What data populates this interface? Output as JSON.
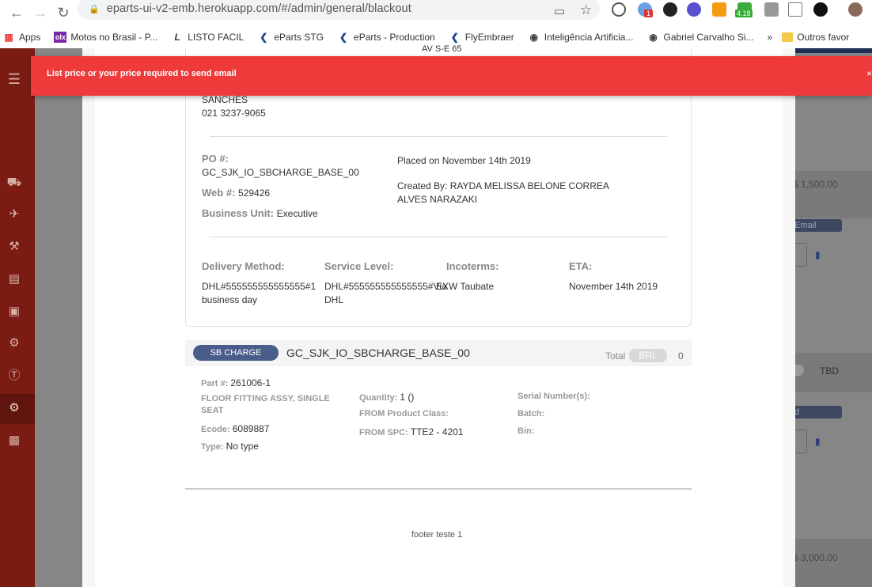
{
  "browser": {
    "url": "eparts-ui-v2-emb.herokuapp.com/#/admin/general/blackout",
    "badge_count": "1",
    "ext_badge": "4.18"
  },
  "bookmarks": [
    {
      "label": "Apps"
    },
    {
      "label": "Motos no Brasil - P..."
    },
    {
      "label": "LISTO FACIL"
    },
    {
      "label": "eParts STG"
    },
    {
      "label": "eParts - Production"
    },
    {
      "label": "FlyEmbraer"
    },
    {
      "label": "Inteligência Artificia..."
    },
    {
      "label": "Gabriel Carvalho Si..."
    },
    {
      "label": "»"
    },
    {
      "label": "Outros favor"
    }
  ],
  "toast": {
    "message": "List price or your price required to send email",
    "close": "×"
  },
  "background": {
    "price1": "$ 1,500.00",
    "email": "Email",
    "tbd": "TBD",
    "d": "d",
    "price2": "$ 3,000.00"
  },
  "address": {
    "line0": "AV S-E 65",
    "name": "SANCHES",
    "phone": "021 3237-9065"
  },
  "order": {
    "po_label": "PO #:",
    "po_value": "GC_SJK_IO_SBCHARGE_BASE_00",
    "web_label": "Web #:",
    "web_value": "529426",
    "bu_label": "Business Unit:",
    "bu_value": "Executive",
    "placed": "Placed on November 14th 2019",
    "created_by_1": "Created By: RAYDA MELISSA BELONE CORREA",
    "created_by_2": "ALVES NARAZAKI"
  },
  "shipping": {
    "delivery_label": "Delivery Method:",
    "delivery_1": "DHL#555555555555555#1",
    "delivery_2": "business day",
    "service_label": "Service Level:",
    "service_1": "DHL#555555555555555#Via",
    "service_2": "DHL",
    "incoterms_label": "Incoterms:",
    "incoterms_value": "EXW Taubate",
    "eta_label": "ETA:",
    "eta_value": "November 14th 2019"
  },
  "item": {
    "type": "SB CHARGE",
    "title": "GC_SJK_IO_SBCHARGE_BASE_00",
    "total_label": "Total",
    "currency": "BRL",
    "total": "0",
    "part_label": "Part #:",
    "part_value": "261006-1",
    "desc_1": "FLOOR FITTING ASSY, SINGLE",
    "desc_2": "SEAT",
    "ecode_label": "Ecode:",
    "ecode_value": "6089887",
    "type_label": "Type:",
    "type_value": "No type",
    "qty_label": "Quantity:",
    "qty_value": "1 ()",
    "class_label": "FROM Product Class:",
    "spc_label": "FROM SPC:",
    "spc_value": "TTE2 - 4201",
    "serial_label": "Serial Number(s):",
    "batch_label": "Batch:",
    "bin_label": "Bin:"
  },
  "footer": {
    "text": "footer teste 1"
  }
}
